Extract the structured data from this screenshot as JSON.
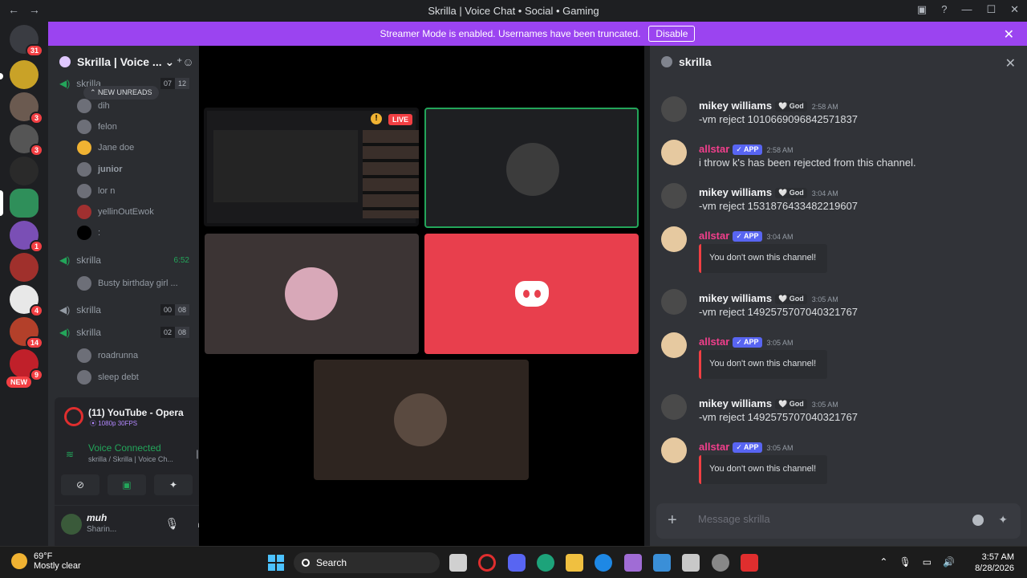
{
  "titlebar": {
    "title": "Skrilla | Voice Chat • Social • Gaming",
    "back": "←",
    "forward": "→"
  },
  "banner": {
    "text": "Streamer Mode is enabled. Usernames have been truncated.",
    "disable_label": "Disable",
    "close": "✕"
  },
  "servers": {
    "badges": [
      "31",
      "3",
      "3",
      "1",
      "4",
      "14",
      "9"
    ],
    "new_label": "NEW"
  },
  "guild": {
    "name": "Skrilla | Voice ... ⌄"
  },
  "channels": {
    "new_unreads": "⌃ NEW UNREADS",
    "vc1": {
      "name": "skrilla",
      "count_a": "07",
      "count_b": "12"
    },
    "vc1_users": [
      "dih",
      "felon",
      "Jane doe",
      "junior",
      "lor n",
      "yellinOutEwok",
      ":"
    ],
    "vc2": {
      "name": "skrilla",
      "timer": "6:52"
    },
    "vc2_users": [
      "Busty birthday girl ..."
    ],
    "vc3": {
      "name": "skrilla",
      "count_a": "00",
      "count_b": "08"
    },
    "vc4": {
      "name": "skrilla",
      "count_a": "02",
      "count_b": "08"
    },
    "vc4_users": [
      "roadrunna",
      "sleep debt"
    ]
  },
  "stream_panel": {
    "title": "(11) YouTube - Opera",
    "quality": "⦿ 1080p 30FPS",
    "voice_status": "Voice Connected",
    "voice_location": "skrilla / Skrilla | Voice Ch...",
    "user_name": "muh",
    "user_status": "Sharin..."
  },
  "stage": {
    "live_label": "LIVE",
    "warn": "!"
  },
  "chat": {
    "channel": "skrilla",
    "messages": [
      {
        "author": "mikey williams",
        "tag": "🤍 God",
        "time": "2:58 AM",
        "text": "-vm reject 1010669096842571837",
        "author_color": "#f2f3f5"
      },
      {
        "author": "allstar",
        "tag": "✓ APP",
        "time": "2:58 AM",
        "text": "i throw k's has been rejected from this channel.",
        "author_color": "#f23f8c"
      },
      {
        "author": "mikey williams",
        "tag": "🤍 God",
        "time": "3:04 AM",
        "text": "-vm reject 1531876433482219607",
        "author_color": "#f2f3f5"
      },
      {
        "author": "allstar",
        "tag": "✓ APP",
        "time": "3:04 AM",
        "text": "You don't own this channel!",
        "author_color": "#f23f8c"
      },
      {
        "author": "mikey williams",
        "tag": "🤍 God",
        "time": "3:05 AM",
        "text": "-vm reject 1492575707040321767",
        "author_color": "#f2f3f5"
      },
      {
        "author": "allstar",
        "tag": "✓ APP",
        "time": "3:05 AM",
        "text": "You don't own this channel!",
        "author_color": "#f23f8c"
      },
      {
        "author": "mikey williams",
        "tag": "🤍 God",
        "time": "3:05 AM",
        "text": "-vm reject 1492575707040321767",
        "author_color": "#f2f3f5"
      },
      {
        "author": "allstar",
        "tag": "✓ APP",
        "time": "3:05 AM",
        "text": "You don't own this channel!",
        "author_color": "#f23f8c"
      }
    ],
    "composer_placeholder": "Message skrilla"
  },
  "taskbar": {
    "temp": "69°F",
    "condition": "Mostly clear",
    "search": "Search",
    "time": "3:57 AM",
    "date": "8/28/2026"
  },
  "colors": {
    "accent": "#9b44f0",
    "connected": "#23a55a",
    "danger": "#f23f43",
    "blurple": "#5865f2"
  }
}
